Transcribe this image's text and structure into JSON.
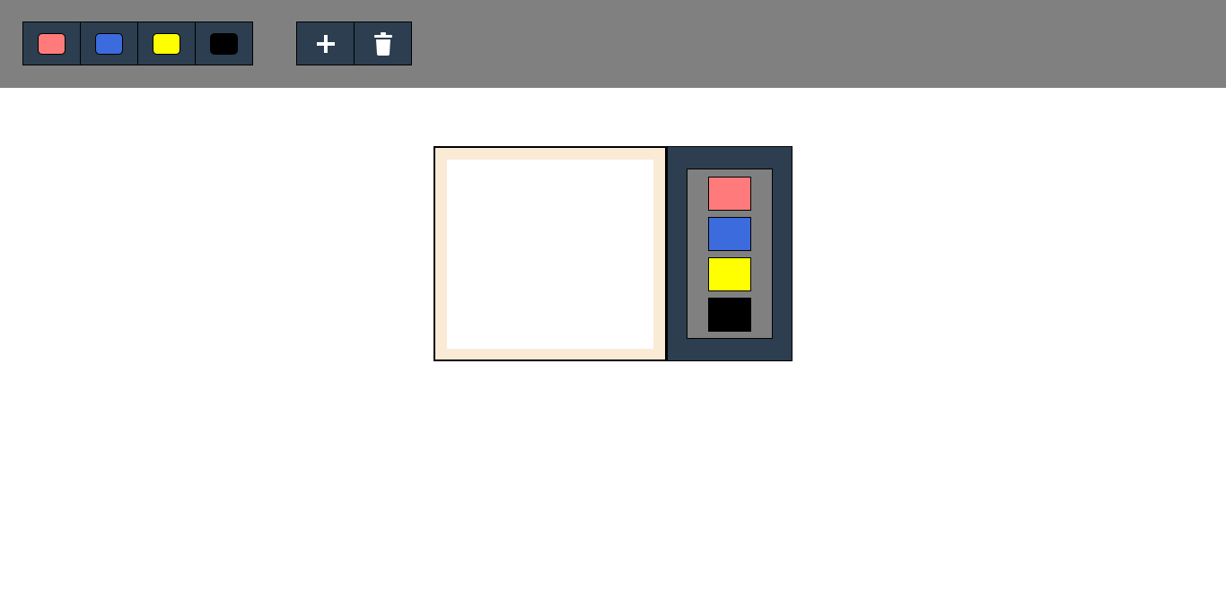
{
  "toolbar": {
    "colors": [
      {
        "name": "salmon",
        "hex": "#ff7b7b"
      },
      {
        "name": "blue",
        "hex": "#3b6bdc"
      },
      {
        "name": "yellow",
        "hex": "#ffff00"
      },
      {
        "name": "black",
        "hex": "#000000"
      }
    ],
    "actions": [
      {
        "name": "add",
        "icon": "plus-icon"
      },
      {
        "name": "delete",
        "icon": "trash-icon"
      }
    ]
  },
  "note": {
    "text": "",
    "background": "#faebd7",
    "palette": [
      {
        "name": "salmon",
        "hex": "#ff7b7b"
      },
      {
        "name": "blue",
        "hex": "#3b6bdc"
      },
      {
        "name": "yellow",
        "hex": "#ffff00"
      },
      {
        "name": "black",
        "hex": "#000000"
      }
    ]
  },
  "theme": {
    "toolbar_bg": "#808080",
    "button_bg": "#2c3e50",
    "panel_bg": "#2c3e50"
  }
}
